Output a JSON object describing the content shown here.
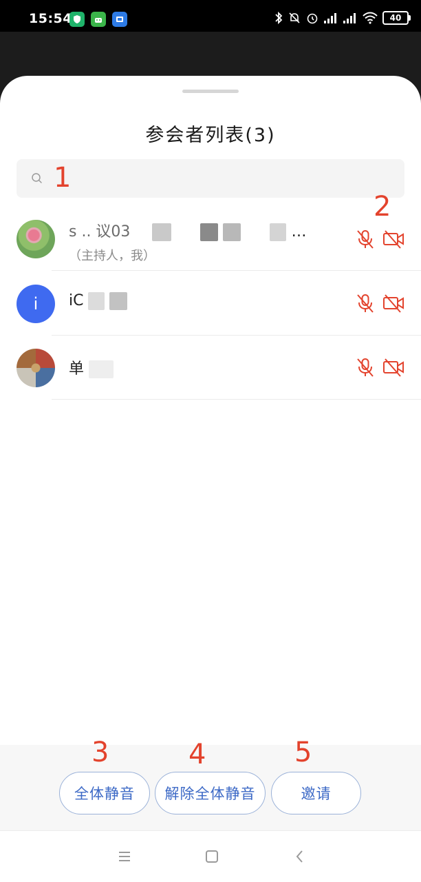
{
  "status_bar": {
    "time": "15:54",
    "battery": "40",
    "app_icons": [
      "shield-app-icon",
      "android-app-icon",
      "screen-cast-app-icon"
    ],
    "indicator_icons": [
      "bluetooth-icon",
      "notifications-off-icon",
      "alarm-icon",
      "signal-icon",
      "signal-icon",
      "wifi-icon",
      "battery-icon"
    ]
  },
  "sheet": {
    "title": "参会者列表(3)",
    "search": {
      "value": "",
      "placeholder": ""
    }
  },
  "participants": [
    {
      "name_visible": "s ..   议03",
      "name_suffix": "…",
      "role": "（主持人，我）",
      "avatar": "photo-lotus",
      "mic": "mic-off-icon",
      "camera": "video-off-icon"
    },
    {
      "name_visible": "iC",
      "role": "",
      "avatar_letter": "i",
      "mic": "mic-off-icon",
      "camera": "video-off-icon"
    },
    {
      "name_visible": "单",
      "role": "",
      "avatar": "photo-patterned",
      "mic": "mic-off-icon",
      "camera": "video-off-icon"
    }
  ],
  "actions": {
    "mute_all": "全体静音",
    "unmute_all": "解除全体静音",
    "invite": "邀请"
  },
  "markers": [
    "1",
    "2",
    "3",
    "4",
    "5"
  ],
  "nav_bar": {
    "icons": [
      "menu-icon",
      "home-icon",
      "back-icon"
    ]
  },
  "colors": {
    "accent_red": "#e3432d",
    "button_text": "#3c69c6",
    "avatar_blue": "#3f6af0"
  }
}
